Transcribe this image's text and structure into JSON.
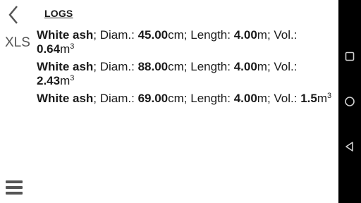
{
  "header": {
    "title": "LOGS",
    "back_icon": "chevron-left-icon"
  },
  "sidebar": {
    "export_label": "XLS",
    "menu_icon": "hamburger-menu-icon"
  },
  "logs": [
    {
      "species": "White ash",
      "diam_label": "; Diam.: ",
      "diam_value": "45.00",
      "diam_unit": "cm; Length: ",
      "length_value": "4.00",
      "length_unit": "m; Vol.: ",
      "vol_value": "0.64",
      "vol_unit": "m",
      "vol_exp": "3"
    },
    {
      "species": "White ash",
      "diam_label": "; Diam.: ",
      "diam_value": "88.00",
      "diam_unit": "cm; Length: ",
      "length_value": "4.00",
      "length_unit": "m; Vol.: ",
      "vol_value": "2.43",
      "vol_unit": "m",
      "vol_exp": "3"
    },
    {
      "species": "White ash",
      "diam_label": "; Diam.: ",
      "diam_value": "69.00",
      "diam_unit": "cm; Length: ",
      "length_value": "4.00",
      "length_unit": "m; Vol.: ",
      "vol_value": "1.5",
      "vol_unit": "m",
      "vol_exp": "3"
    }
  ],
  "system_nav": {
    "recents_icon": "square-recents-icon",
    "home_icon": "circle-home-icon",
    "back_icon": "triangle-back-icon"
  },
  "colors": {
    "background": "#ffffff",
    "text": "#1a1a1a",
    "icon_gray": "#555555",
    "navbar": "#000000"
  }
}
